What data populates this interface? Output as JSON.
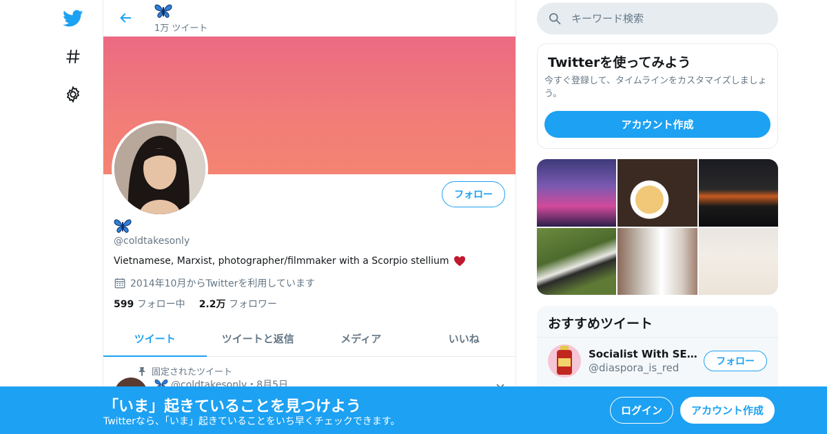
{
  "nav": {
    "icons": [
      "twitter-bird-icon",
      "hashtag-icon",
      "gear-icon"
    ]
  },
  "header": {
    "display_name_emoji": "butterfly",
    "tweet_count": "1万 ツイート"
  },
  "profile": {
    "display_name_emoji": "butterfly",
    "handle": "@coldtakesonly",
    "bio": "Vietnamese, Marxist, photographer/filmmaker with a Scorpio stellium",
    "bio_emoji": "♥",
    "joined": "2014年10月からTwitterを利用しています",
    "following_count": "599",
    "following_label": "フォロー中",
    "followers_count": "2.2万",
    "followers_label": "フォロワー",
    "follow_button": "フォロー"
  },
  "tabs": [
    {
      "label": "ツイート",
      "active": true
    },
    {
      "label": "ツイートと返信",
      "active": false
    },
    {
      "label": "メディア",
      "active": false
    },
    {
      "label": "いいね",
      "active": false
    }
  ],
  "pinned": {
    "label": "固定されたツイート",
    "meta": "@coldtakesonly・8月5日"
  },
  "sidebar": {
    "search_placeholder": "キーワード検索",
    "signup_card": {
      "title": "Twitterを使ってみよう",
      "description": "今すぐ登録して、タイムラインをカスタマイズしましょう。",
      "button": "アカウント作成"
    },
    "recommended": {
      "title": "おすすめツイート",
      "account_name": "Socialist With SE Asi...",
      "account_handle": "@diaspora_is_red",
      "follow_button": "フォロー"
    }
  },
  "bottom_bar": {
    "title": "「いま」起きていることを見つけよう",
    "subtitle": "Twitterなら、「いま」起きていることをいち早くチェックできます。",
    "login_button": "ログイン",
    "signup_button": "アカウント作成"
  },
  "colors": {
    "accent": "#1da1f2",
    "banner_top": "#ec6a82",
    "banner_bottom": "#f48472",
    "heart": "#c0192f"
  }
}
